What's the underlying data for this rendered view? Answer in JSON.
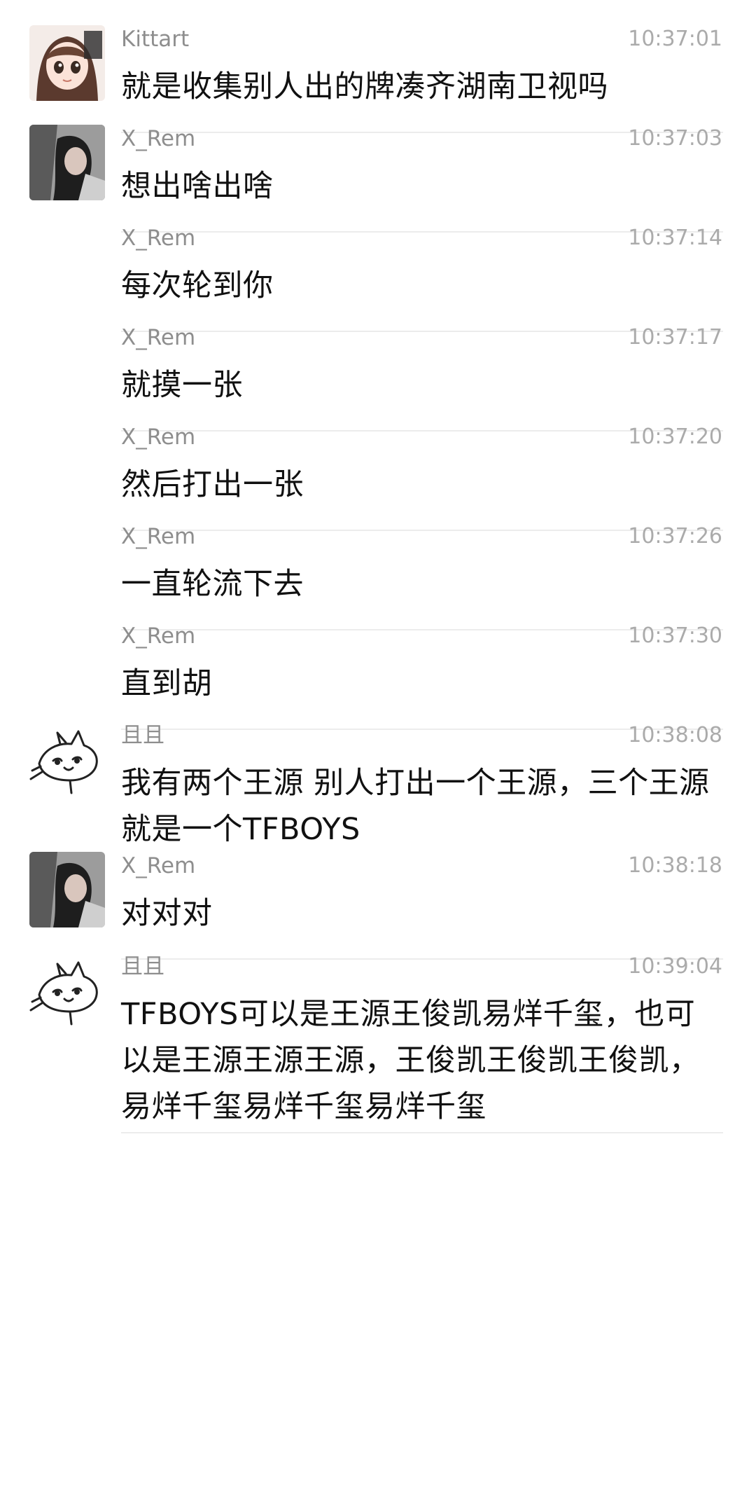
{
  "chat": {
    "messages": [
      {
        "sender": "Kittart",
        "time": "10:37:01",
        "text": "就是收集别人出的牌凑齐湖南卫视吗",
        "avatar": "anime-girl-avatar"
      },
      {
        "sender": "X_Rem",
        "time": "10:37:03",
        "text": "想出啥出啥",
        "avatar": "photo-girl-avatar"
      },
      {
        "sender": "X_Rem",
        "time": "10:37:14",
        "text": "每次轮到你"
      },
      {
        "sender": "X_Rem",
        "time": "10:37:17",
        "text": "就摸一张"
      },
      {
        "sender": "X_Rem",
        "time": "10:37:20",
        "text": "然后打出一张"
      },
      {
        "sender": "X_Rem",
        "time": "10:37:26",
        "text": "一直轮流下去"
      },
      {
        "sender": "X_Rem",
        "time": "10:37:30",
        "text": "直到胡"
      },
      {
        "sender": "且且",
        "time": "10:38:08",
        "text": "我有两个王源 别人打出一个王源，三个王源就是一个TFBOYS",
        "avatar": "cat-doodle-avatar"
      },
      {
        "sender": "X_Rem",
        "time": "10:38:18",
        "text": "对对对",
        "avatar": "photo-girl-avatar"
      },
      {
        "sender": "且且",
        "time": "10:39:04",
        "text": "TFBOYS可以是王源王俊凯易烊千玺，也可以是王源王源王源，王俊凯王俊凯王俊凯，易烊千玺易烊千玺易烊千玺",
        "avatar": "cat-doodle-avatar"
      }
    ]
  },
  "colors": {
    "background": "#ffffff",
    "sender": "#8e8e8e",
    "time": "#ababab",
    "text": "#111111",
    "divider": "#ececec"
  }
}
